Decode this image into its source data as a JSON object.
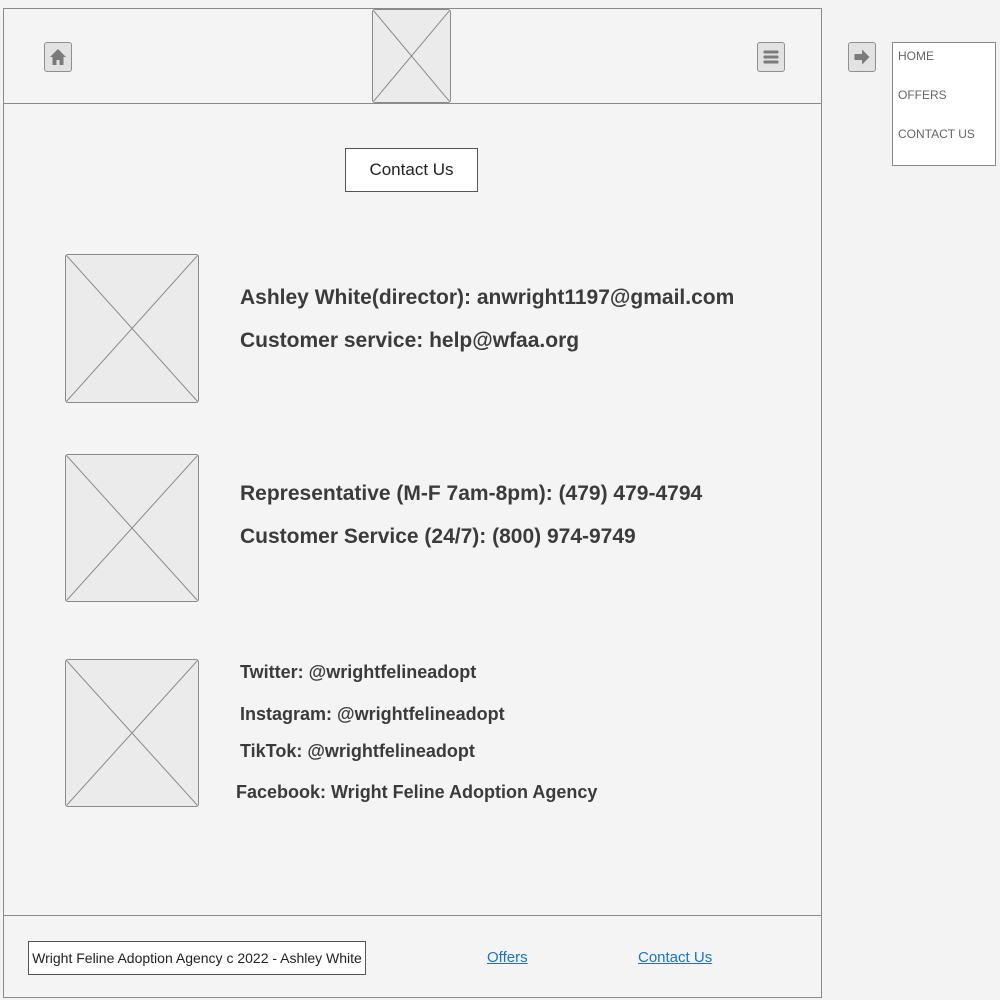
{
  "header": {
    "home_icon": "home-icon",
    "logo_placeholder": "image-placeholder",
    "menu_icon": "hamburger-menu-icon"
  },
  "main": {
    "title": "Contact Us",
    "sections": [
      {
        "image": "image-placeholder",
        "lines": [
          "Ashley White(director): anwright1197@gmail.com",
          "Customer service: help@wfaa.org"
        ]
      },
      {
        "image": "image-placeholder",
        "lines": [
          "Representative (M-F 7am-8pm): (479) 479-4794",
          "Customer Service (24/7): (800) 974-9749"
        ]
      },
      {
        "image": "image-placeholder",
        "lines": [
          "Twitter: @wrightfelineadopt",
          "Instagram: @wrightfelineadopt",
          "TikTok: @wrightfelineadopt",
          "Facebook: Wright Feline Adoption Agency"
        ]
      }
    ]
  },
  "side_menu": {
    "arrow_icon": "arrow-right-icon",
    "items": [
      "HOME",
      "OFFERS",
      "CONTACT US"
    ]
  },
  "footer": {
    "credit": "Wright Feline Adoption Agency c 2022 - Ashley White",
    "links": [
      "Offers",
      "Contact Us"
    ]
  },
  "colors": {
    "background": "#f3f3f3",
    "border": "#8a8a8a",
    "link": "#1a73c9",
    "text": "#3b3b3b"
  }
}
